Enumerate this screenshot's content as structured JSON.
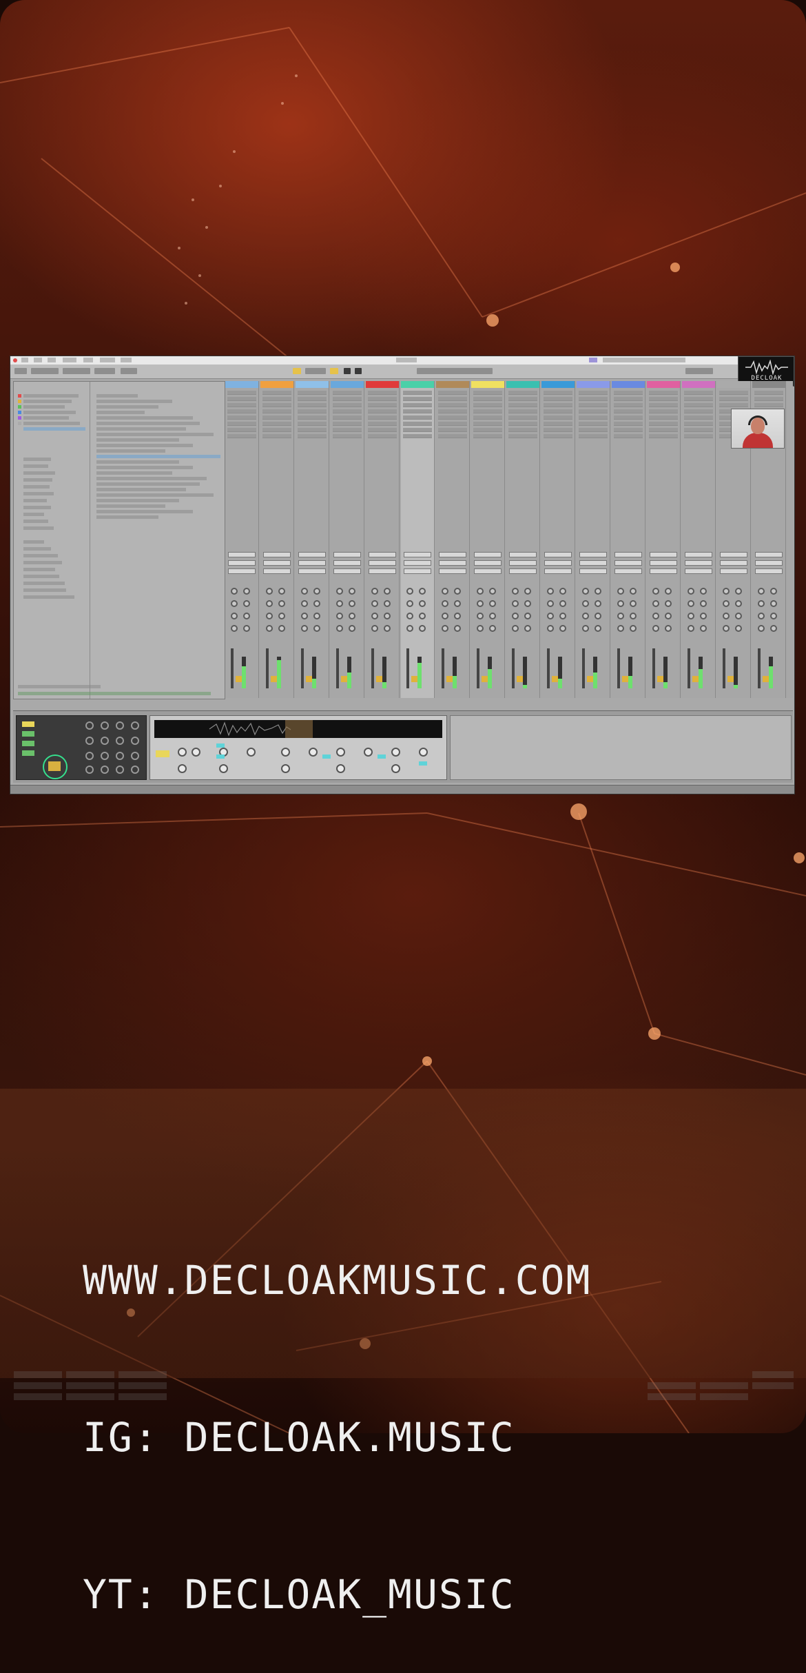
{
  "overlay": {
    "website": "WWW.DECLOAKMUSIC.COM",
    "instagram": "IG: DECLOAK.MUSIC",
    "youtube": "YT: DECLOAK_MUSIC"
  },
  "logo": {
    "text": "DECLOAK"
  },
  "colors": {
    "background_dark": "#2a0d07",
    "background_glow": "#aa3719",
    "daw_panel": "#a9a9a9",
    "accent_green": "#35e08d",
    "accent_yellow": "#e6c24a"
  },
  "daw": {
    "track_header_colors": [
      "#7fb2e0",
      "#f0a040",
      "#8fc0e8",
      "#6aa8dc",
      "#e03a3a",
      "#4ad0a8",
      "#b08a5a",
      "#f0e060",
      "#3ac0b0",
      "#3a9ad8",
      "#8a9ae8",
      "#6a8ae0",
      "#e060a0",
      "#d070c0",
      "#aaaaaa",
      "#888888"
    ]
  },
  "icons": {
    "logo": "waveform-logo-icon",
    "record_dot": "record-dot-icon"
  }
}
